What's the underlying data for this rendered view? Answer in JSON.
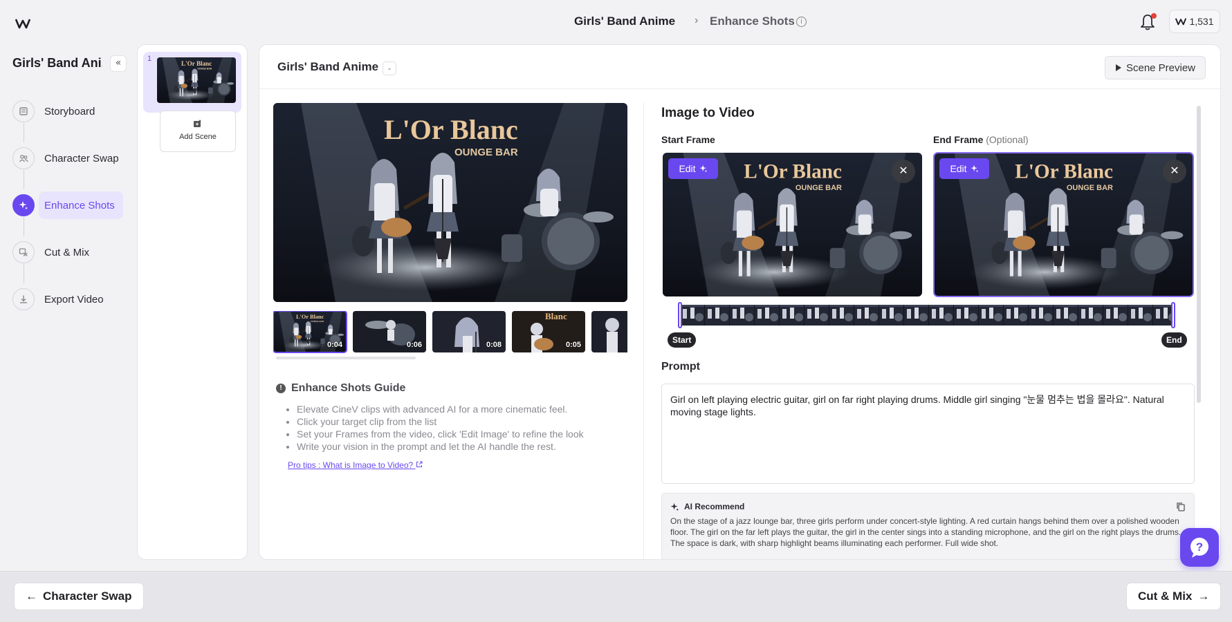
{
  "header": {
    "project_name": "Girls' Band Anime",
    "separator": "›",
    "current_step": "Enhance Shots",
    "info_glyph": "i",
    "credits": "1,531",
    "icons": {
      "logo": "brand-logo-icon",
      "notifications": "bell-icon",
      "credits": "brand-coin-icon"
    }
  },
  "sidebar": {
    "title": "Girls' Band Ani...",
    "collapse_glyph": "«",
    "steps": [
      {
        "label": "Storyboard",
        "icon": "storyboard-icon",
        "active": false
      },
      {
        "label": "Character Swap",
        "icon": "people-icon",
        "active": false
      },
      {
        "label": "Enhance Shots",
        "icon": "sparkle-icon",
        "active": true
      },
      {
        "label": "Cut & Mix",
        "icon": "cut-mix-icon",
        "active": false
      },
      {
        "label": "Export Video",
        "icon": "download-icon",
        "active": false
      }
    ]
  },
  "scenes": {
    "items": [
      {
        "number": "1"
      }
    ],
    "add_label": "Add Scene"
  },
  "main": {
    "title": "Girls' Band Anime",
    "title_caret": "⌄",
    "scene_preview_label": "Scene Preview",
    "image_text": {
      "sign": "L'Or Blanc",
      "sub": "OUNGE BAR"
    },
    "clips": [
      {
        "duration": "0:04",
        "selected": true
      },
      {
        "duration": "0:06",
        "selected": false
      },
      {
        "duration": "0:08",
        "selected": false
      },
      {
        "duration": "0:05",
        "selected": false
      }
    ],
    "guide": {
      "title": "Enhance Shots Guide",
      "items": [
        "Elevate CineV clips with advanced AI for a more cinematic feel.",
        "Click your target clip from the list",
        "Set your Frames from the video, click 'Edit Image' to refine the look",
        "Write your vision in the prompt and let the AI handle the rest."
      ],
      "link": "Pro tips : What is Image to Video?"
    }
  },
  "i2v": {
    "title": "Image to Video",
    "start_label": "Start Frame",
    "end_label": "End Frame",
    "end_optional": "(Optional)",
    "edit_label": "Edit",
    "close_glyph": "✕",
    "start_pill": "Start",
    "end_pill": "End",
    "prompt_label": "Prompt",
    "prompt_value": "Girl on left playing electric guitar, girl on far right playing drums. Middle girl singing \"눈물 멈추는 법을 몰라요\". Natural moving stage lights.",
    "ai_title": "AI Recommend",
    "ai_text": "On the stage of a jazz lounge bar, three girls perform under concert-style lighting. A red curtain hangs behind them over a polished wooden floor. The girl on the far left plays the guitar, the girl in the center sings into a standing microphone, and the girl on the right plays the drums. The space is dark, with sharp highlight beams illuminating each performer. Full wide shot."
  },
  "footer": {
    "back_label": "Character Swap",
    "next_label": "Cut & Mix",
    "back_arrow": "←",
    "next_arrow": "→"
  },
  "colors": {
    "accent": "#6a48f0",
    "accent_light": "#e9e4fd"
  }
}
